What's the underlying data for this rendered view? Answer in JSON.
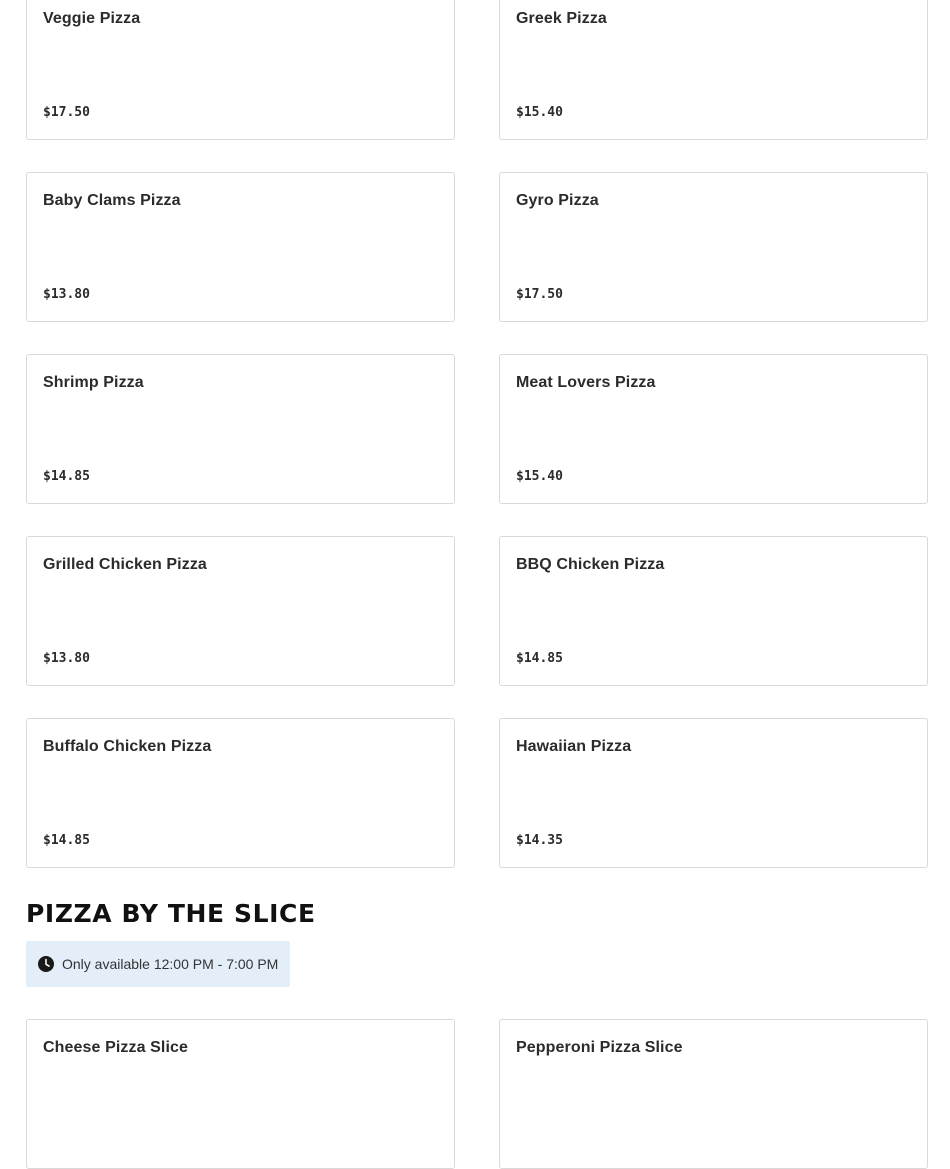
{
  "menu_items": [
    {
      "name": "Veggie Pizza",
      "price": "$17.50"
    },
    {
      "name": "Greek Pizza",
      "price": "$15.40"
    },
    {
      "name": "Baby Clams Pizza",
      "price": "$13.80"
    },
    {
      "name": "Gyro Pizza",
      "price": "$17.50"
    },
    {
      "name": "Shrimp Pizza",
      "price": "$14.85"
    },
    {
      "name": "Meat Lovers Pizza",
      "price": "$15.40"
    },
    {
      "name": "Grilled Chicken Pizza",
      "price": "$13.80"
    },
    {
      "name": "BBQ Chicken Pizza",
      "price": "$14.85"
    },
    {
      "name": "Buffalo Chicken Pizza",
      "price": "$14.85"
    },
    {
      "name": "Hawaiian Pizza",
      "price": "$14.35"
    }
  ],
  "slice_section": {
    "title": "PIZZA BY THE SLICE",
    "availability": "Only available 12:00 PM - 7:00 PM",
    "availability_icon": "clock-icon",
    "availability_bg": "#e4eef9",
    "items": [
      {
        "name": "Cheese Pizza Slice"
      },
      {
        "name": "Pepperoni Pizza Slice"
      }
    ]
  }
}
